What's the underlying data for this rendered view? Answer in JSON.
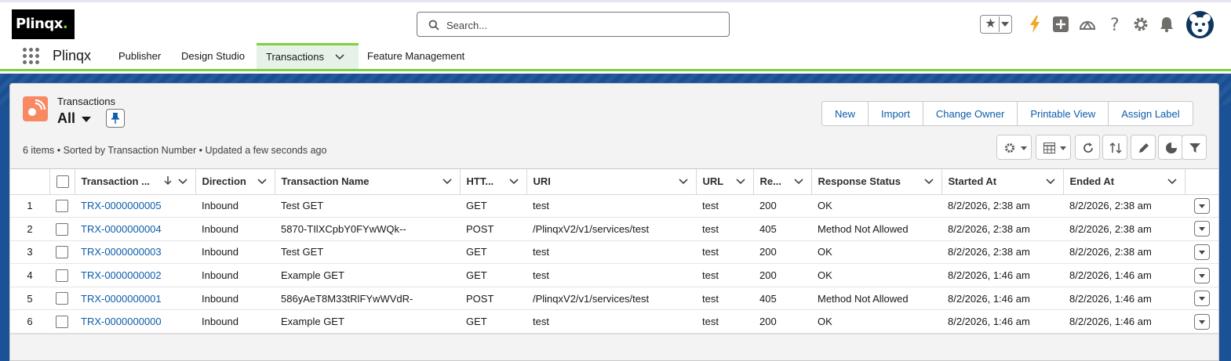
{
  "brand": {
    "logo_text": "Plinqx",
    "logo_dot": "."
  },
  "search": {
    "placeholder": "Search..."
  },
  "header_icons": [
    "favorites-star-icon",
    "lightning-icon",
    "add-icon",
    "trailhead-icon",
    "help-icon",
    "setup-gear-icon",
    "notifications-bell-icon",
    "user-avatar"
  ],
  "app": {
    "name": "Plinqx",
    "nav": [
      {
        "label": "Publisher",
        "active": false
      },
      {
        "label": "Design Studio",
        "active": false
      },
      {
        "label": "Transactions",
        "active": true
      },
      {
        "label": "Feature Management",
        "active": false
      }
    ]
  },
  "list_view": {
    "object_label": "Transactions",
    "view_name": "All",
    "meta": "6 items • Sorted by Transaction Number • Updated a few seconds ago",
    "actions": [
      "New",
      "Import",
      "Change Owner",
      "Printable View",
      "Assign Label"
    ],
    "toolbar_icons": [
      "list-settings-icon",
      "display-as-table-icon",
      "refresh-icon",
      "sort-icon",
      "edit-icon",
      "chart-icon",
      "filter-icon"
    ]
  },
  "table": {
    "columns": [
      "Transaction ...",
      "Direction",
      "Transaction Name",
      "HTT...",
      "URI",
      "URL",
      "Re...",
      "Response Status",
      "Started At",
      "Ended At"
    ],
    "rows": [
      {
        "n": "1",
        "id": "TRX-0000000005",
        "direction": "Inbound",
        "name": "Test GET",
        "method": "GET",
        "uri": "test",
        "url": "test",
        "code": "200",
        "status": "OK",
        "started": "8/2/2026, 2:38 am",
        "ended": "8/2/2026, 2:38 am"
      },
      {
        "n": "2",
        "id": "TRX-0000000004",
        "direction": "Inbound",
        "name": "5870-TIlXCpbY0FYwWQk--",
        "method": "POST",
        "uri": "/PlinqxV2/v1/services/test",
        "url": "test",
        "code": "405",
        "status": "Method Not Allowed",
        "started": "8/2/2026, 2:38 am",
        "ended": "8/2/2026, 2:38 am"
      },
      {
        "n": "3",
        "id": "TRX-0000000003",
        "direction": "Inbound",
        "name": "Test GET",
        "method": "GET",
        "uri": "test",
        "url": "test",
        "code": "200",
        "status": "OK",
        "started": "8/2/2026, 2:38 am",
        "ended": "8/2/2026, 2:38 am"
      },
      {
        "n": "4",
        "id": "TRX-0000000002",
        "direction": "Inbound",
        "name": "Example GET",
        "method": "GET",
        "uri": "test",
        "url": "test",
        "code": "200",
        "status": "OK",
        "started": "8/2/2026, 1:46 am",
        "ended": "8/2/2026, 1:46 am"
      },
      {
        "n": "5",
        "id": "TRX-0000000001",
        "direction": "Inbound",
        "name": "586yAeT8M33tRlFYwWVdR-",
        "method": "POST",
        "uri": "/PlinqxV2/v1/services/test",
        "url": "test",
        "code": "405",
        "status": "Method Not Allowed",
        "started": "8/2/2026, 1:46 am",
        "ended": "8/2/2026, 1:46 am"
      },
      {
        "n": "6",
        "id": "TRX-0000000000",
        "direction": "Inbound",
        "name": "Example GET",
        "method": "GET",
        "uri": "test",
        "url": "test",
        "code": "200",
        "status": "OK",
        "started": "8/2/2026, 1:46 am",
        "ended": "8/2/2026, 1:46 am"
      }
    ]
  },
  "colors": {
    "accent_green": "#7fd13b",
    "link_blue": "#0b5cab",
    "band_blue": "#1b5297",
    "object_icon": "#f88962"
  }
}
